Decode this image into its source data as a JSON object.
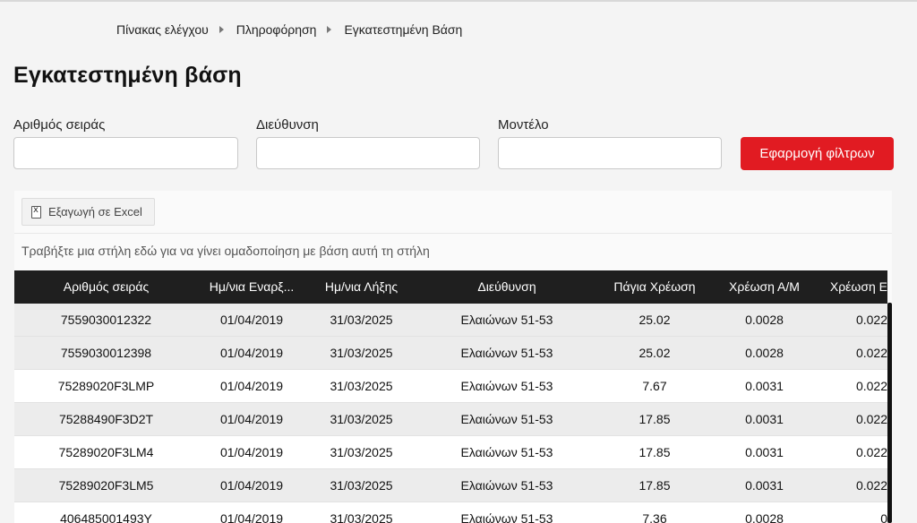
{
  "breadcrumb": {
    "items": [
      "Πίνακας ελέγχου",
      "Πληροφόρηση",
      "Εγκατεστημένη Βάση"
    ]
  },
  "page": {
    "title": "Εγκατεστημένη βάση"
  },
  "filters": {
    "serial_label": "Αριθμός σειράς",
    "serial_value": "",
    "address_label": "Διεύθυνση",
    "address_value": "",
    "model_label": "Μοντέλο",
    "model_value": "",
    "apply_label": "Εφαρμογή φίλτρων"
  },
  "grid": {
    "export_label": "Εξαγωγή σε Excel",
    "export_icon": "excel-file-icon",
    "group_hint": "Τραβήξτε μια στήλη εδώ για να γίνει ομαδοποίηση με βάση αυτή τη στήλη",
    "columns": [
      "Αριθμός σειράς",
      "Ημ/νια Εναρξ...",
      "Ημ/νια Λήξης",
      "Διεύθυνση",
      "Πάγια Χρέωση",
      "Χρέωση Α/Μ",
      "Χρέωση Ε"
    ],
    "rows": [
      [
        "7559030012322",
        "01/04/2019",
        "31/03/2025",
        "Ελαιώνων 51-53",
        "25.02",
        "0.0028",
        "0.022"
      ],
      [
        "7559030012398",
        "01/04/2019",
        "31/03/2025",
        "Ελαιώνων 51-53",
        "25.02",
        "0.0028",
        "0.022"
      ],
      [
        "75289020F3LMP",
        "01/04/2019",
        "31/03/2025",
        "Ελαιώνων 51-53",
        "7.67",
        "0.0031",
        "0.022"
      ],
      [
        "75288490F3D2T",
        "01/04/2019",
        "31/03/2025",
        "Ελαιώνων 51-53",
        "17.85",
        "0.0031",
        "0.022"
      ],
      [
        "75289020F3LM4",
        "01/04/2019",
        "31/03/2025",
        "Ελαιώνων 51-53",
        "17.85",
        "0.0031",
        "0.022"
      ],
      [
        "75289020F3LM5",
        "01/04/2019",
        "31/03/2025",
        "Ελαιώνων 51-53",
        "17.85",
        "0.0031",
        "0.022"
      ],
      [
        "406485001493Y",
        "01/04/2019",
        "31/03/2025",
        "Ελαιώνων 51-53",
        "7.36",
        "0.0028",
        "0"
      ]
    ]
  }
}
